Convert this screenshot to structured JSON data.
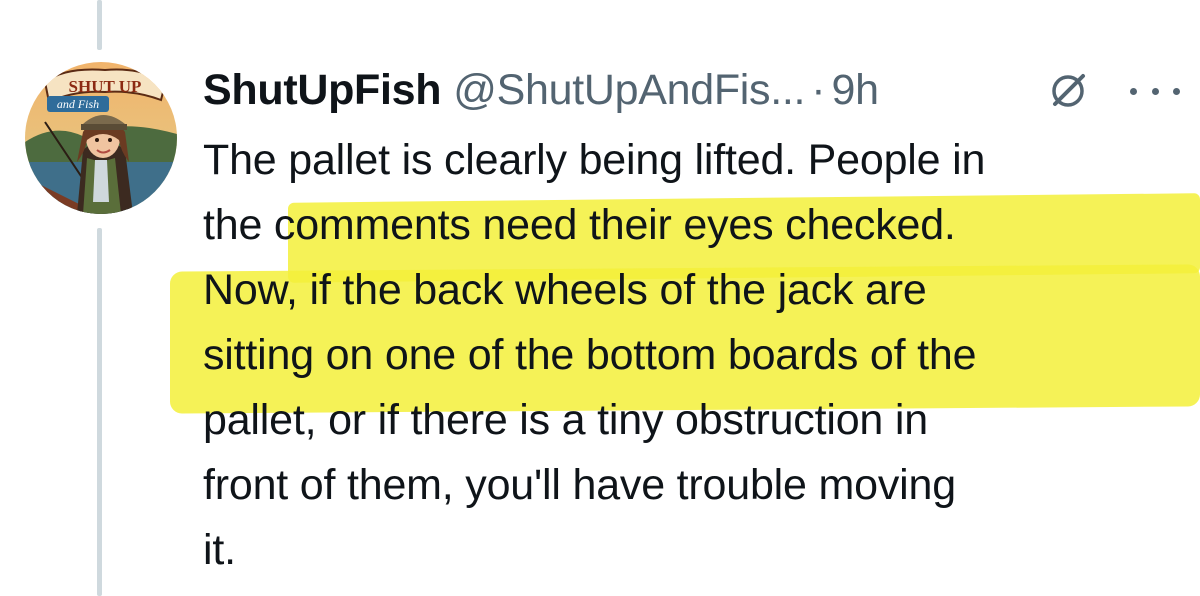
{
  "tweet": {
    "display_name": "ShutUpFish",
    "handle": "@ShutUpAndFis...",
    "separator": "·",
    "time": "9h",
    "lines": [
      "The pallet is clearly being lifted. People in",
      "the comments need their eyes checked.",
      "Now, if the back wheels of the jack are",
      "sitting on one of the bottom boards of the",
      "pallet, or if there is a tiny obstruction in",
      "front of them, you'll have trouble moving",
      "it."
    ]
  },
  "avatar": {
    "logo_text_top": "SHUT UP",
    "logo_text_bottom": "and Fish"
  },
  "icons": {
    "grok": "grok-slash-circle-icon",
    "more": "more-options-icon"
  },
  "colors": {
    "text": "#0f1419",
    "secondary": "#536471",
    "highlight": "#f3f03a",
    "thread_line": "#cfd9de"
  }
}
